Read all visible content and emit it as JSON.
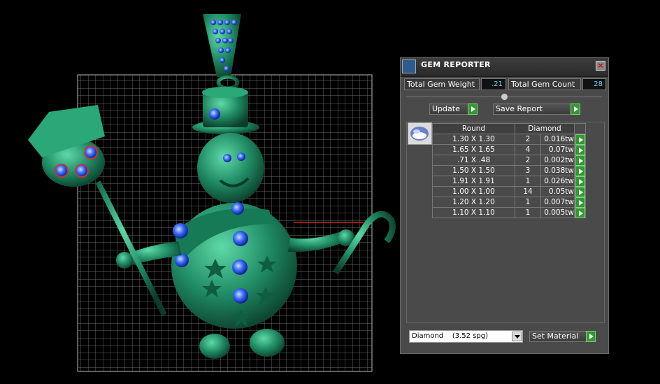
{
  "window": {
    "title": "GEM REPORTER"
  },
  "summary": {
    "weight_label": "Total Gem Weight",
    "weight_value": ".21",
    "count_label": "Total Gem Count",
    "count_value": "28"
  },
  "actions": {
    "update_label": "Update",
    "save_label": "Save Report"
  },
  "table": {
    "headers": [
      "Round",
      "Diamond"
    ],
    "rows": [
      {
        "size": "1.30 X 1.30",
        "count": "2",
        "weight": "0.016tw"
      },
      {
        "size": "1.65 X 1.65",
        "count": "4",
        "weight": "0.07tw"
      },
      {
        "size": ".71 X .48",
        "count": "2",
        "weight": "0.002tw"
      },
      {
        "size": "1.50 X 1.50",
        "count": "3",
        "weight": "0.038tw"
      },
      {
        "size": "1.91 X 1.91",
        "count": "1",
        "weight": "0.026tw"
      },
      {
        "size": "1.00 X 1.00",
        "count": "14",
        "weight": "0.05tw"
      },
      {
        "size": "1.20 X 1.20",
        "count": "1",
        "weight": "0.007tw"
      },
      {
        "size": "1.10 X 1.10",
        "count": "1",
        "weight": "0.005tw"
      }
    ]
  },
  "material": {
    "selected": "Diamond    (3.52 spg)",
    "set_label": "Set Material"
  },
  "colors": {
    "model": "#1f8a63",
    "gem": "#3a6bff",
    "value_text": "#5fd3ff",
    "go_button": "#2f9a2f"
  },
  "icons": {
    "window": "gem-reporter-icon",
    "close": "close-icon",
    "gem": "round-gem-icon",
    "go": "play-arrow-icon"
  }
}
